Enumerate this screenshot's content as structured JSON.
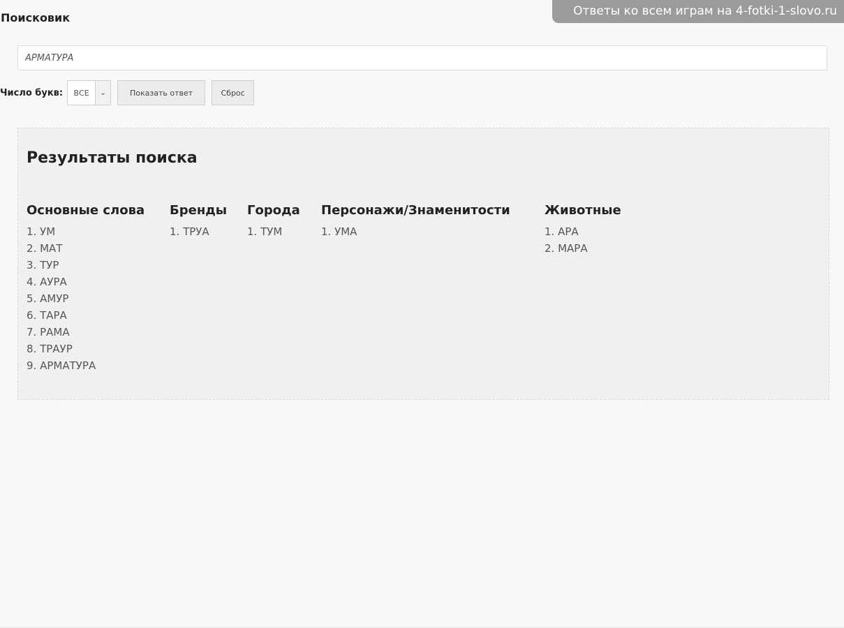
{
  "watermark": "Ответы ко всем играм на 4-fotki-1-slovo.ru",
  "title": "Поисковик",
  "search": {
    "value": "АРМАТУРА"
  },
  "controls": {
    "letters_label": "Число букв:",
    "letters_selected": "ВСЕ",
    "show_button": "Показать ответ",
    "reset_button": "Сброс"
  },
  "results": {
    "heading": "Результаты поиска",
    "columns": [
      {
        "heading": "Основные слова",
        "items": [
          "1. УМ",
          "2. МАТ",
          "3. ТУР",
          "4. АУРА",
          "5. АМУР",
          "6. ТАРА",
          "7. РАМА",
          "8. ТРАУР",
          "9. АРМАТУРА"
        ]
      },
      {
        "heading": "Бренды",
        "items": [
          "1. ТРУА"
        ]
      },
      {
        "heading": "Города",
        "items": [
          "1. ТУМ"
        ]
      },
      {
        "heading": "Персонажи/Знаменитости",
        "items": [
          "1. УМА"
        ]
      },
      {
        "heading": "Животные",
        "items": [
          "1. АРА",
          "2. МАРА"
        ]
      }
    ]
  }
}
